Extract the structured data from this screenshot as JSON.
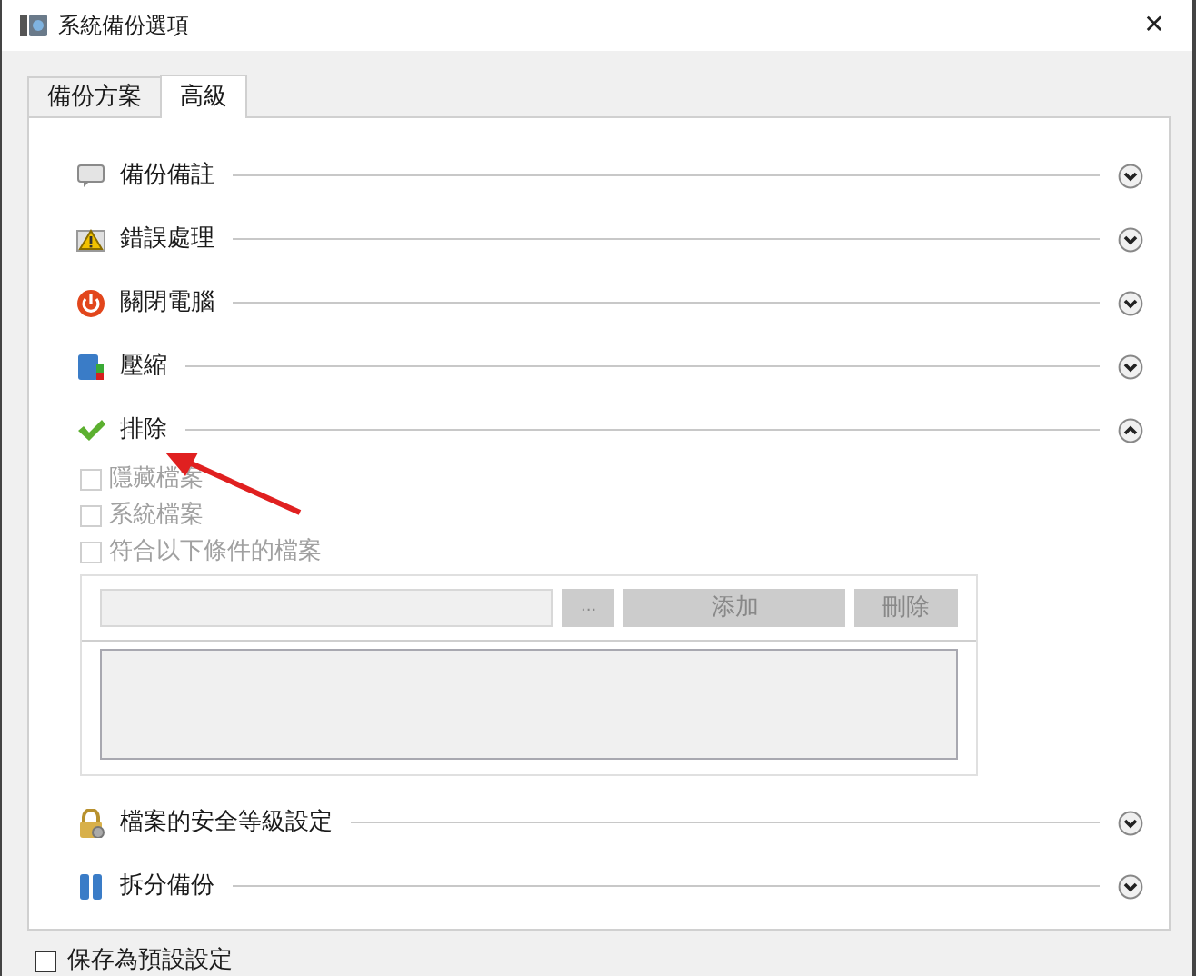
{
  "window": {
    "title": "系統備份選項",
    "close": "✕"
  },
  "tabs": [
    {
      "label": "備份方案",
      "selected": false
    },
    {
      "label": "高級",
      "selected": true
    }
  ],
  "sections": [
    {
      "label": "備份備註",
      "kind": "note",
      "expanded": false
    },
    {
      "label": "錯誤處理",
      "kind": "warning",
      "expanded": false
    },
    {
      "label": "關閉電腦",
      "kind": "power",
      "expanded": false
    },
    {
      "label": "壓縮",
      "kind": "compress",
      "expanded": false
    },
    {
      "label": "排除",
      "kind": "check",
      "expanded": true,
      "options": [
        {
          "label": "隱藏檔案",
          "checked": false,
          "disabled": true
        },
        {
          "label": "系統檔案",
          "checked": false,
          "disabled": true
        },
        {
          "label": "符合以下條件的檔案",
          "checked": false,
          "disabled": true
        }
      ],
      "browse_button": "...",
      "add_button": "添加",
      "delete_button": "刪除"
    },
    {
      "label": "檔案的安全等級設定",
      "kind": "lock",
      "expanded": false
    },
    {
      "label": "拆分備份",
      "kind": "split",
      "expanded": false
    }
  ],
  "save_default": {
    "label": "保存為預設設定",
    "checked": false
  }
}
